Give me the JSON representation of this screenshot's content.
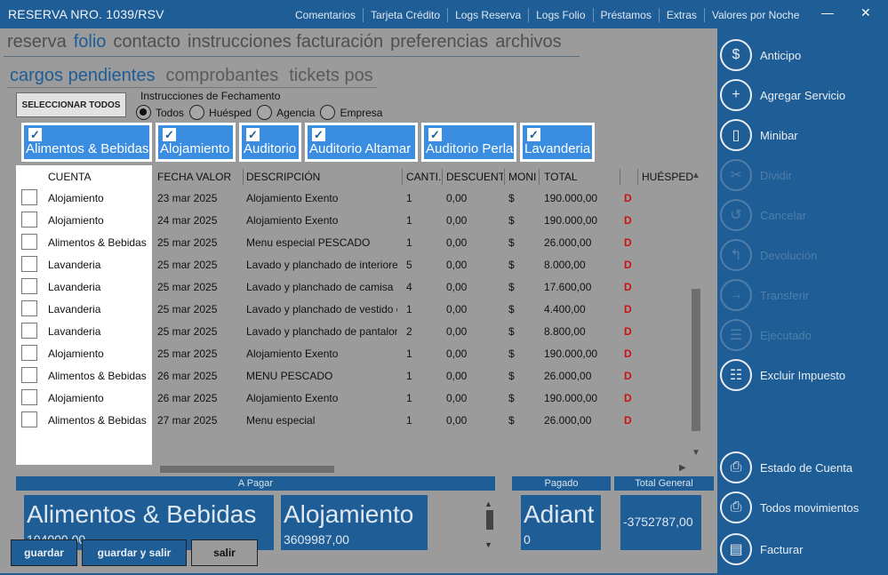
{
  "window": {
    "title": "RESERVA NRO. 1039/RSV",
    "minimize": "—",
    "close": "✕"
  },
  "topmenu": [
    "Comentarios",
    "Tarjeta Crédito",
    "Logs Reserva",
    "Logs Folio",
    "Préstamos",
    "Extras",
    "Valores por Noche"
  ],
  "tabs": [
    "reserva",
    "folio",
    "contacto",
    "instrucciones facturación",
    "preferencias",
    "archivos"
  ],
  "active_tab": "folio",
  "subtabs": [
    "cargos pendientes",
    "comprobantes",
    "tickets pos"
  ],
  "active_subtab": "cargos pendientes",
  "select_all_button": "SELECCIONAR TODOS",
  "instructions": {
    "label": "Instrucciones de Fechamento",
    "options": [
      "Todos",
      "Huésped",
      "Agencia",
      "Empresa"
    ],
    "selected": "Todos"
  },
  "filters": [
    {
      "label": "Alimentos & Bebidas",
      "checked": true
    },
    {
      "label": "Alojamiento",
      "checked": true
    },
    {
      "label": "Auditorio",
      "checked": true
    },
    {
      "label": "Auditorio Altamar",
      "checked": true
    },
    {
      "label": "Auditorio Perla",
      "checked": true
    },
    {
      "label": "Lavanderia",
      "checked": true
    }
  ],
  "columns": [
    "CUENTA",
    "FECHA VALOR",
    "DESCRIPCIÓN",
    "CANTI.",
    "DESCUENTO",
    "MONI",
    "TOTAL",
    "",
    "HUÉSPED"
  ],
  "rows": [
    {
      "cuenta": "Alojamiento",
      "fecha": "23 mar 2025",
      "desc": "Alojamiento Exento",
      "cant": "1",
      "desc_pct": "0,00",
      "moneda": "$",
      "total": "190.000,00",
      "flag": "D"
    },
    {
      "cuenta": "Alojamiento",
      "fecha": "24 mar 2025",
      "desc": "Alojamiento Exento",
      "cant": "1",
      "desc_pct": "0,00",
      "moneda": "$",
      "total": "190.000,00",
      "flag": "D"
    },
    {
      "cuenta": "Alimentos & Bebidas",
      "fecha": "25 mar 2025",
      "desc": "Menu especial PESCADO",
      "cant": "1",
      "desc_pct": "0,00",
      "moneda": "$",
      "total": "26.000,00",
      "flag": "D"
    },
    {
      "cuenta": "Lavanderia",
      "fecha": "25 mar 2025",
      "desc": "Lavado y planchado de interiores",
      "cant": "5",
      "desc_pct": "0,00",
      "moneda": "$",
      "total": "8.000,00",
      "flag": "D"
    },
    {
      "cuenta": "Lavanderia",
      "fecha": "25 mar 2025",
      "desc": "Lavado y planchado de camisa",
      "cant": "4",
      "desc_pct": "0,00",
      "moneda": "$",
      "total": "17.600,00",
      "flag": "D"
    },
    {
      "cuenta": "Lavanderia",
      "fecha": "25 mar 2025",
      "desc": "Lavado y planchado de vestido o",
      "cant": "1",
      "desc_pct": "0,00",
      "moneda": "$",
      "total": "4.400,00",
      "flag": "D"
    },
    {
      "cuenta": "Lavanderia",
      "fecha": "25 mar 2025",
      "desc": "Lavado y planchado de pantalon",
      "cant": "2",
      "desc_pct": "0,00",
      "moneda": "$",
      "total": "8.800,00",
      "flag": "D"
    },
    {
      "cuenta": "Alojamiento",
      "fecha": "25 mar 2025",
      "desc": "Alojamiento Exento",
      "cant": "1",
      "desc_pct": "0,00",
      "moneda": "$",
      "total": "190.000,00",
      "flag": "D"
    },
    {
      "cuenta": "Alimentos & Bebidas",
      "fecha": "26 mar 2025",
      "desc": "MENU PESCADO",
      "cant": "1",
      "desc_pct": "0,00",
      "moneda": "$",
      "total": "26.000,00",
      "flag": "D"
    },
    {
      "cuenta": "Alojamiento",
      "fecha": "26 mar 2025",
      "desc": "Alojamiento Exento",
      "cant": "1",
      "desc_pct": "0,00",
      "moneda": "$",
      "total": "190.000,00",
      "flag": "D"
    },
    {
      "cuenta": "Alimentos & Bebidas",
      "fecha": "27 mar 2025",
      "desc": "Menu especial",
      "cant": "1",
      "desc_pct": "0,00",
      "moneda": "$",
      "total": "26.000,00",
      "flag": "D"
    }
  ],
  "summary": {
    "a_pagar_label": "A Pagar",
    "pagado_label": "Pagado",
    "total_general_label": "Total General",
    "cards": [
      {
        "name": "Alimentos & Bebidas",
        "amount": "104000,00"
      },
      {
        "name": "Alojamiento",
        "amount": "3609987,00"
      }
    ],
    "pagado": {
      "name": "Adiant",
      "amount": "0"
    },
    "total_general": "-3752787,00"
  },
  "buttons": {
    "guardar": "guardar",
    "guardar_salir": "guardar y salir",
    "salir": "salir"
  },
  "sidebar": [
    {
      "label": "Anticipo",
      "icon": "cash-icon",
      "glyph": "$",
      "enabled": true
    },
    {
      "label": "Agregar Servicio",
      "icon": "add-service-icon",
      "glyph": "+",
      "enabled": true
    },
    {
      "label": "Minibar",
      "icon": "minibar-icon",
      "glyph": "▯",
      "enabled": true
    },
    {
      "label": "Dividir",
      "icon": "scissors-icon",
      "glyph": "✂",
      "enabled": false
    },
    {
      "label": "Cancelar",
      "icon": "undo-icon",
      "glyph": "↺",
      "enabled": false
    },
    {
      "label": "Devolución",
      "icon": "return-icon",
      "glyph": "↰",
      "enabled": false
    },
    {
      "label": "Transferir",
      "icon": "arrow-right-icon",
      "glyph": "→",
      "enabled": false
    },
    {
      "label": "Ejecutado",
      "icon": "checklist-icon",
      "glyph": "☰",
      "enabled": false
    },
    {
      "label": "Excluir Impuesto",
      "icon": "exclude-tax-icon",
      "glyph": "☷",
      "enabled": true
    },
    {
      "label": "Estado de Cuenta",
      "icon": "printer-icon",
      "glyph": "⎙",
      "enabled": true
    },
    {
      "label": "Todos movimientos",
      "icon": "printer-icon",
      "glyph": "⎙",
      "enabled": true
    },
    {
      "label": "Facturar",
      "icon": "document-icon",
      "glyph": "▤",
      "enabled": true
    }
  ]
}
